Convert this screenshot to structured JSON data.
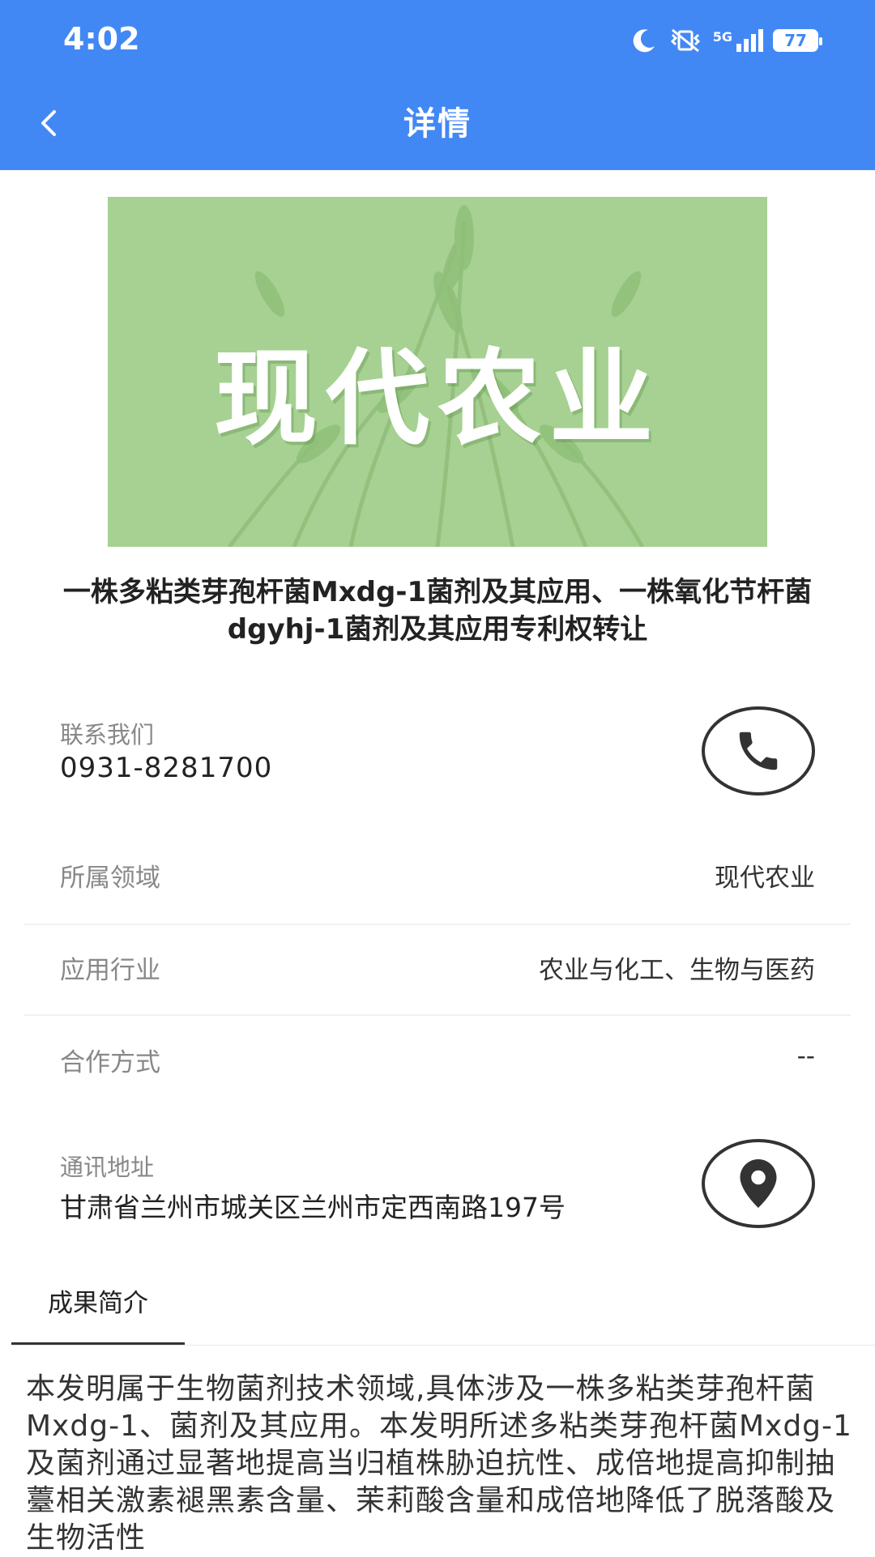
{
  "status_bar": {
    "time": "4:02",
    "network": "5G",
    "battery": "77"
  },
  "nav": {
    "title": "详情"
  },
  "banner": {
    "text": "现代农业",
    "background": "#a6d192"
  },
  "item": {
    "title": "一株多粘类芽孢杆菌Mxdg-1菌剂及其应用、一株氧化节杆菌dgyhj-1菌剂及其应用专利权转让"
  },
  "contact": {
    "label": "联系我们",
    "value": "0931-8281700"
  },
  "fields": {
    "domain_label": "所属领域",
    "domain_value": "现代农业",
    "industry_label": "应用行业",
    "industry_value": "农业与化工、生物与医药",
    "coop_label": "合作方式",
    "coop_value": "--"
  },
  "address": {
    "label": "通讯地址",
    "value": "甘肃省兰州市城关区兰州市定西南路197号"
  },
  "tabs": {
    "summary_label": "成果简介"
  },
  "summary": {
    "text": "本发明属于生物菌剂技术领域,具体涉及一株多粘类芽孢杆菌Mxdg-1、菌剂及其应用。本发明所述多粘类芽孢杆菌Mxdg-1及菌剂通过显著地提高当归植株胁迫抗性、成倍地提高抑制抽薹相关激素褪黑素含量、茉莉酸含量和成倍地降低了脱落酸及生物活性"
  },
  "colors": {
    "header": "#4288f4",
    "banner": "#a6d192"
  }
}
